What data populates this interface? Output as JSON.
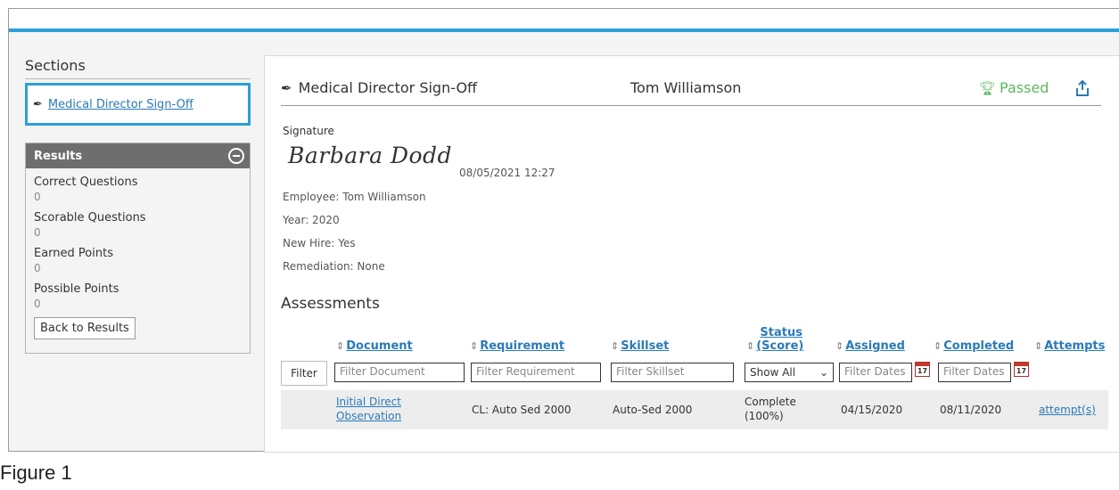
{
  "sidebar": {
    "sections_title": "Sections",
    "active_section": "Medical Director Sign-Off",
    "results": {
      "title": "Results",
      "stats": [
        {
          "label": "Correct Questions",
          "value": "0"
        },
        {
          "label": "Scorable Questions",
          "value": "0"
        },
        {
          "label": "Earned Points",
          "value": "0"
        },
        {
          "label": "Possible Points",
          "value": "0"
        }
      ],
      "back_label": "Back to Results"
    }
  },
  "card": {
    "title": "Medical Director Sign-Off",
    "employee_name": "Tom Williamson",
    "status": "Passed",
    "signature_label": "Signature",
    "signature_name": "Barbara Dodd",
    "signature_date": "08/05/2021 12:27",
    "info": [
      "Employee: Tom Williamson",
      "Year: 2020",
      "New Hire: Yes",
      "Remediation: None"
    ],
    "assessments_title": "Assessments"
  },
  "table": {
    "headers": {
      "document": "Document",
      "requirement": "Requirement",
      "skillset": "Skillset",
      "status_line1": "Status",
      "status_line2": "(Score)",
      "assigned": "Assigned",
      "completed": "Completed",
      "attempts": "Attempts"
    },
    "filters": {
      "filter_button": "Filter",
      "document_placeholder": "Filter Document",
      "requirement_placeholder": "Filter Requirement",
      "skillset_placeholder": "Filter Skillset",
      "status_select": "Show All",
      "assigned_placeholder": "Filter Dates",
      "completed_placeholder": "Filter Dates",
      "calendar_day": "17"
    },
    "rows": [
      {
        "document_line1": "Initial Direct",
        "document_line2": "Observation",
        "requirement": "CL: Auto Sed 2000",
        "skillset": "Auto-Sed 2000",
        "status_line1": "Complete",
        "status_line2": "(100%)",
        "assigned": "04/15/2020",
        "completed": "08/11/2020",
        "attempts": "attempt(s)"
      }
    ]
  },
  "caption": "Figure 1",
  "colors": {
    "accent": "#2a9fd8",
    "link": "#2a7ab8",
    "passed": "#5cb85c",
    "results_header": "#6e6e6e"
  }
}
